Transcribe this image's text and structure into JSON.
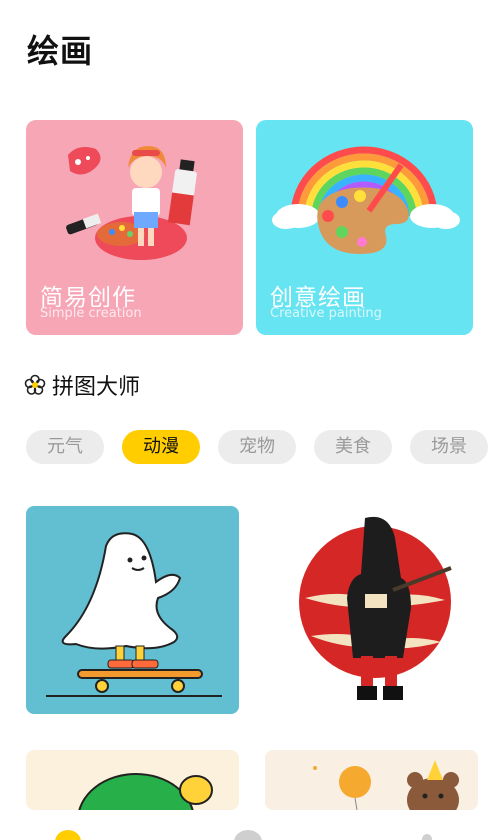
{
  "page": {
    "title": "绘画"
  },
  "cards": [
    {
      "title": "简易创作",
      "subtitle": "Simple creation"
    },
    {
      "title": "创意绘画",
      "subtitle": "Creative painting"
    }
  ],
  "puzzle": {
    "icon": "flower-icon",
    "title": "拼图大师",
    "categories": [
      {
        "label": "元气",
        "active": false
      },
      {
        "label": "动漫",
        "active": true
      },
      {
        "label": "宠物",
        "active": false
      },
      {
        "label": "美食",
        "active": false
      },
      {
        "label": "场景",
        "active": false
      }
    ]
  },
  "colors": {
    "accent": "#ffcd00",
    "chip_bg": "#ececec",
    "card_pink": "#f7a6b6",
    "card_blue": "#66e4f2"
  },
  "tabbar": {
    "icons": [
      "home-icon",
      "paint-icon",
      "profile-icon"
    ]
  }
}
